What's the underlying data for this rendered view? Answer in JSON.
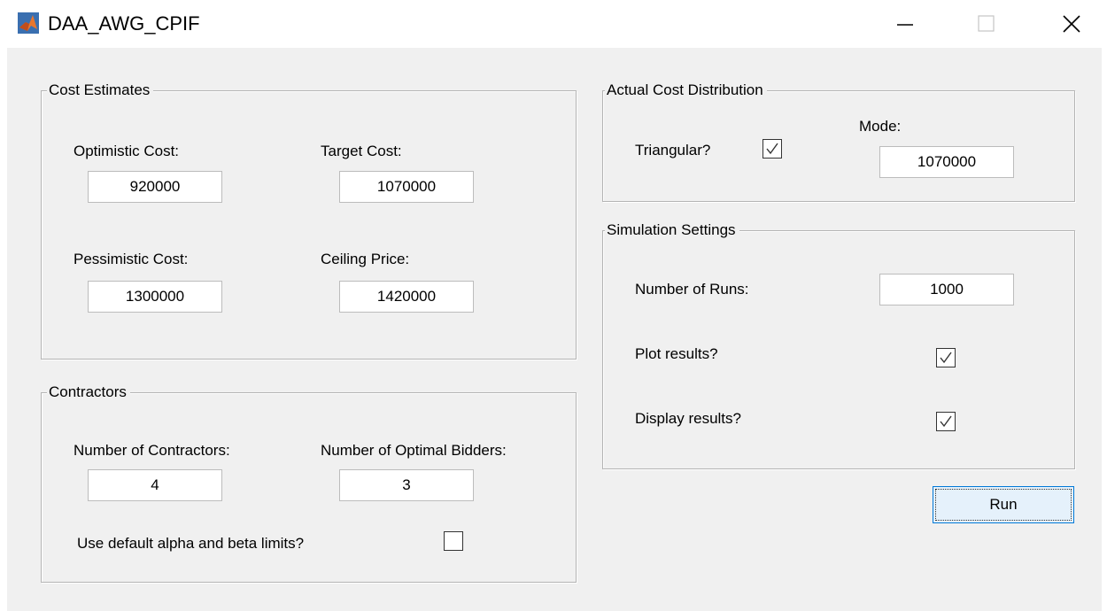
{
  "window": {
    "title": "DAA_AWG_CPIF",
    "icon": "matlab-icon",
    "controls": [
      "minimize-icon",
      "maximize-icon",
      "close-icon"
    ]
  },
  "cost_estimates": {
    "title": "Cost Estimates",
    "optimistic_label": "Optimistic Cost:",
    "optimistic_value": "920000",
    "target_label": "Target Cost:",
    "target_value": "1070000",
    "pessimistic_label": "Pessimistic Cost:",
    "pessimistic_value": "1300000",
    "ceiling_label": "Ceiling Price:",
    "ceiling_value": "1420000"
  },
  "contractors": {
    "title": "Contractors",
    "num_contractors_label": "Number of Contractors:",
    "num_contractors_value": "4",
    "num_bidders_label": "Number of Optimal Bidders:",
    "num_bidders_value": "3",
    "default_limits_label": "Use default alpha and beta limits?",
    "default_limits_checked": false
  },
  "actual_cost": {
    "title": "Actual Cost Distribution",
    "triangular_label": "Triangular?",
    "triangular_checked": true,
    "mode_label": "Mode:",
    "mode_value": "1070000"
  },
  "simulation": {
    "title": "Simulation Settings",
    "runs_label": "Number of Runs:",
    "runs_value": "1000",
    "plot_label": "Plot results?",
    "plot_checked": true,
    "display_label": "Display results?",
    "display_checked": true
  },
  "run_button": {
    "label": "Run"
  }
}
